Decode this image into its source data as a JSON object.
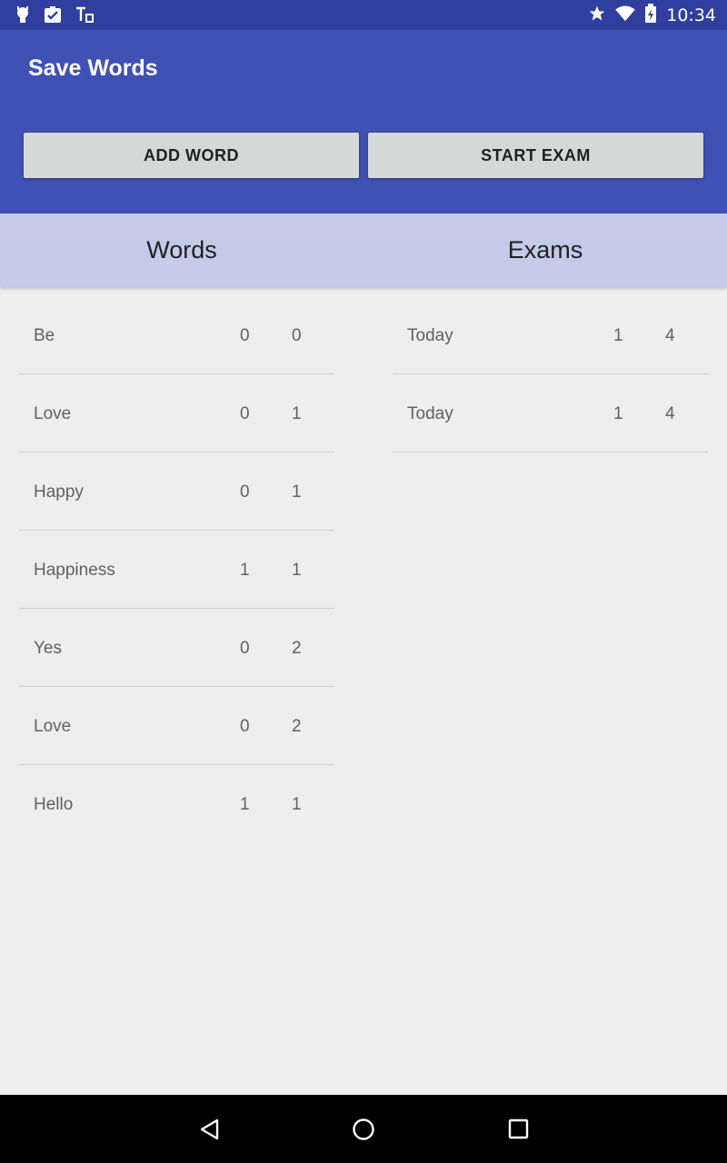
{
  "status_bar": {
    "time": "10:34",
    "icons": [
      "android-debug-icon",
      "clipboard-check-icon",
      "translate-icon",
      "star-icon",
      "wifi-icon",
      "battery-charging-icon"
    ]
  },
  "app_bar": {
    "title": "Save Words",
    "add_word_label": "ADD WORD",
    "start_exam_label": "START EXAM",
    "color": "#3f51b5",
    "status_color": "#303f9f"
  },
  "tabs": {
    "words_label": "Words",
    "exams_label": "Exams",
    "color": "#c5cae9"
  },
  "words": [
    {
      "word": "Be",
      "a": "0",
      "b": "0"
    },
    {
      "word": "Love",
      "a": "0",
      "b": "1"
    },
    {
      "word": "Happy",
      "a": "0",
      "b": "1"
    },
    {
      "word": "Happiness",
      "a": "1",
      "b": "1"
    },
    {
      "word": "Yes",
      "a": "0",
      "b": "2"
    },
    {
      "word": "Love",
      "a": "0",
      "b": "2"
    },
    {
      "word": "Hello",
      "a": "1",
      "b": "1"
    }
  ],
  "exams": [
    {
      "date": "Today",
      "a": "1",
      "b": "4"
    },
    {
      "date": "Today",
      "a": "1",
      "b": "4"
    }
  ],
  "nav_bar": {
    "icons": [
      "back-icon",
      "home-icon",
      "recents-icon"
    ]
  }
}
